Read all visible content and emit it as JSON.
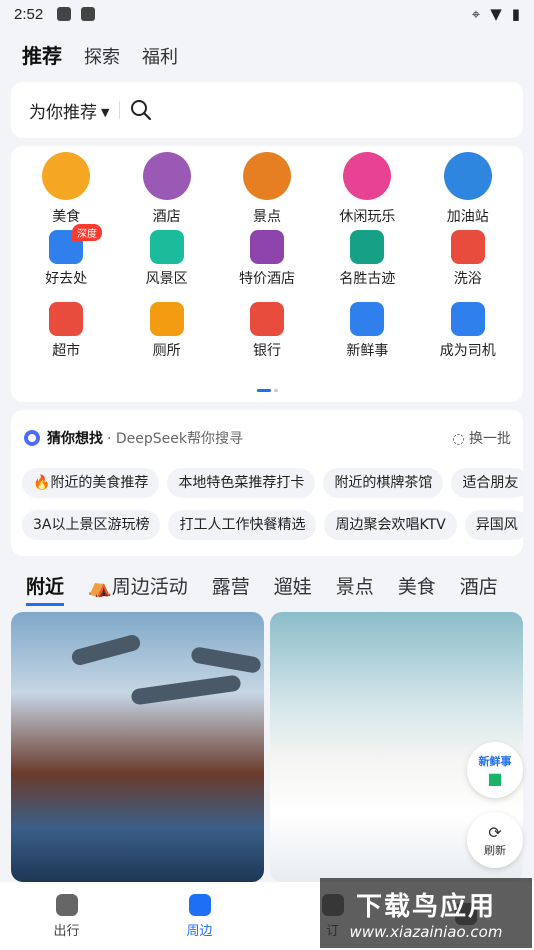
{
  "status_bar": {
    "time": "2:52"
  },
  "top_tabs": [
    {
      "label": "推荐",
      "active": true
    },
    {
      "label": "探索"
    },
    {
      "label": "福利"
    }
  ],
  "search": {
    "label": "为你推荐"
  },
  "categories": [
    {
      "label": "美食",
      "icon": "food-icon",
      "color": "#f5a623"
    },
    {
      "label": "酒店",
      "icon": "hotel-icon",
      "color": "#9b59b6"
    },
    {
      "label": "景点",
      "icon": "scenic-icon",
      "color": "#e67e22"
    },
    {
      "label": "休闲玩乐",
      "icon": "game-icon",
      "color": "#e84393"
    },
    {
      "label": "加油站",
      "icon": "fuel-icon",
      "color": "#2e86de"
    },
    {
      "label": "好去处",
      "icon": "ai-icon",
      "color": "#2f80ed",
      "badge": "深度"
    },
    {
      "label": "风景区",
      "icon": "mountain-icon",
      "color": "#1abc9c"
    },
    {
      "label": "特价酒店",
      "icon": "building-icon",
      "color": "#8e44ad"
    },
    {
      "label": "名胜古迹",
      "icon": "pagoda-icon",
      "color": "#16a085"
    },
    {
      "label": "洗浴",
      "icon": "bath-icon",
      "color": "#e74c3c"
    },
    {
      "label": "超市",
      "icon": "cart-icon",
      "color": "#e74c3c"
    },
    {
      "label": "厕所",
      "icon": "toilet-icon",
      "color": "#f39c12"
    },
    {
      "label": "银行",
      "icon": "card-icon",
      "color": "#e74c3c"
    },
    {
      "label": "新鲜事",
      "icon": "camera-icon",
      "color": "#2f80ed"
    },
    {
      "label": "成为司机",
      "icon": "driver-icon",
      "color": "#2f80ed"
    }
  ],
  "guess": {
    "title": "猜你想找",
    "subtitle": "· DeepSeek帮你搜寻",
    "refresh_label": "换一批",
    "row1": [
      "附近的美食推荐",
      "本地特色菜推荐打卡",
      "附近的棋牌茶馆",
      "适合朋友"
    ],
    "row2": [
      "3A以上景区游玩榜",
      "打工人工作快餐精选",
      "周边聚会欢唱KTV",
      "异国风"
    ]
  },
  "feed_tabs": [
    "附近",
    "周边活动",
    "露营",
    "遛娃",
    "景点",
    "美食",
    "酒店"
  ],
  "fabs": {
    "news_label": "新鲜事",
    "refresh_label": "刷新"
  },
  "bottom_nav": [
    {
      "label": "出行"
    },
    {
      "label": "周边",
      "active": true
    },
    {
      "label": "订"
    },
    {
      "label": ""
    }
  ],
  "watermark": {
    "title": "下载鸟应用",
    "url": "www.xiazainiao.com"
  },
  "colors": {
    "accent": "#1e6ff5",
    "card_bg": "#ffffff",
    "page_bg": "#f2f4f8"
  }
}
